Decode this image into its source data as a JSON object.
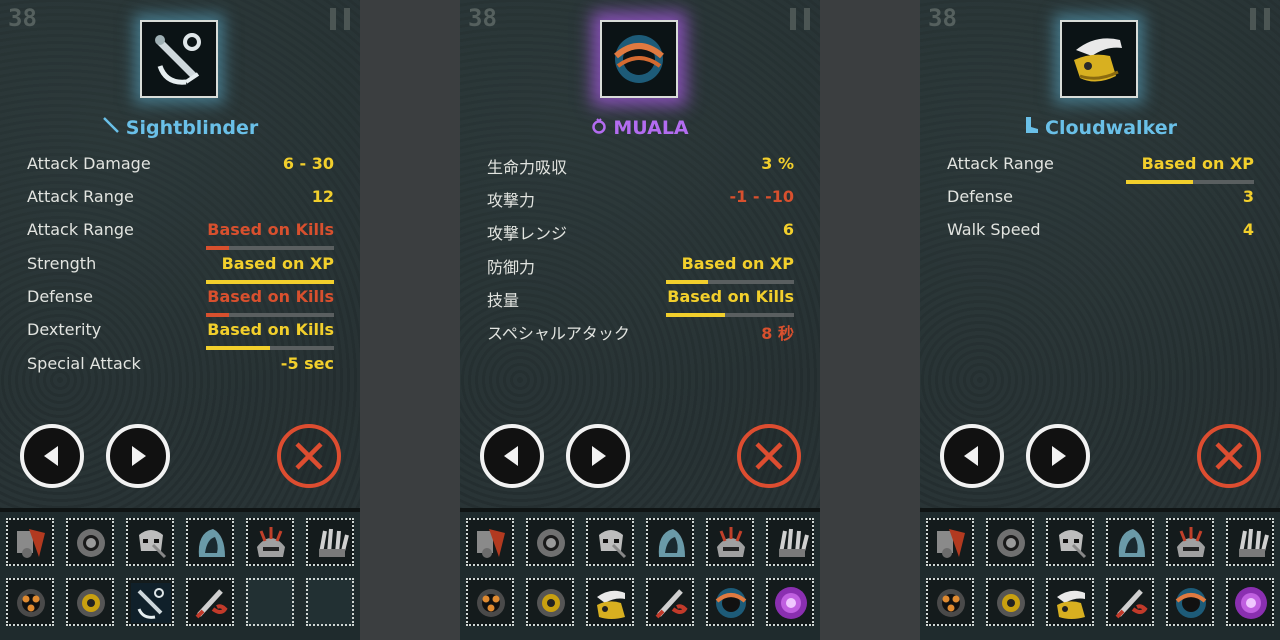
{
  "colors": {
    "yellow": "#f2cf2c",
    "red": "#d8502e",
    "blue_title": "#6ac0e8",
    "purple_title": "#b36cf0",
    "bar_track": "#5a5f60"
  },
  "panels": [
    {
      "level": "38",
      "title": "Sightblinder",
      "title_color": "#6ac0e8",
      "title_icon": "dagger-icon",
      "item_icon": "anchor-icon",
      "stats": [
        {
          "label": "Attack Damage",
          "value": "6 - 30",
          "color": "#f2cf2c"
        },
        {
          "label": "Attack Range",
          "value": "12",
          "color": "#f2cf2c"
        },
        {
          "label": "Attack Range",
          "value": "Based on Kills",
          "color": "#d8502e",
          "bar": true,
          "fill": 0.18
        },
        {
          "label": "Strength",
          "value": "Based on XP",
          "color": "#f2cf2c",
          "bar": true,
          "fill": 1.0
        },
        {
          "label": "Defense",
          "value": "Based on Kills",
          "color": "#d8502e",
          "bar": true,
          "fill": 0.18
        },
        {
          "label": "Dexterity",
          "value": "Based on Kills",
          "color": "#f2cf2c",
          "bar": true,
          "fill": 0.5
        },
        {
          "label": "Special Attack",
          "value": "-5 sec",
          "color": "#f2cf2c"
        }
      ],
      "inventory": [
        "gauntlet-icon",
        "lion-ring-icon",
        "skull-helm-icon",
        "hood-icon",
        "spiked-helm-icon",
        "claw-glove-icon",
        "orange-ring-icon",
        "gold-ring-icon",
        "anchor-icon",
        "red-sword-icon",
        "empty",
        "empty"
      ]
    },
    {
      "level": "38",
      "title": "MUALA",
      "title_color": "#b36cf0",
      "title_icon": "ring-icon",
      "item_icon": "blue-ring-icon",
      "stats": [
        {
          "label": "生命力吸収",
          "value": "3 %",
          "color": "#f2cf2c"
        },
        {
          "label": "攻撃力",
          "value": "-1 - -10",
          "color": "#d8502e"
        },
        {
          "label": "攻撃レンジ",
          "value": "6",
          "color": "#f2cf2c"
        },
        {
          "label": "防御力",
          "value": "Based on XP",
          "color": "#f2cf2c",
          "bar": true,
          "fill": 0.33
        },
        {
          "label": "技量",
          "value": "Based on Kills",
          "color": "#f2cf2c",
          "bar": true,
          "fill": 0.46
        },
        {
          "label": "スペシャルアタック",
          "value": "8 秒",
          "color": "#d8502e"
        }
      ],
      "inventory": [
        "gauntlet-icon",
        "lion-ring-icon",
        "skull-helm-icon",
        "hood-icon",
        "spiked-helm-icon",
        "claw-glove-icon",
        "orange-ring-icon",
        "gold-ring-icon",
        "winged-boot-icon",
        "red-sword-icon",
        "blue-ring-icon",
        "purple-ring-icon"
      ]
    },
    {
      "level": "38",
      "title": "Cloudwalker",
      "title_color": "#6ac0e8",
      "title_icon": "boot-icon",
      "item_icon": "winged-boot-icon",
      "stats": [
        {
          "label": "Attack Range",
          "value": "Based on XP",
          "color": "#f2cf2c",
          "bar": true,
          "fill": 0.52
        },
        {
          "label": "Defense",
          "value": "3",
          "color": "#f2cf2c"
        },
        {
          "label": "Walk Speed",
          "value": "4",
          "color": "#f2cf2c"
        }
      ],
      "inventory": [
        "gauntlet-icon",
        "lion-ring-icon",
        "skull-helm-icon",
        "hood-icon",
        "spiked-helm-icon",
        "claw-glove-icon",
        "orange-ring-icon",
        "gold-ring-icon",
        "winged-boot-icon",
        "red-sword-icon",
        "blue-ring-icon",
        "purple-ring-icon"
      ]
    }
  ]
}
